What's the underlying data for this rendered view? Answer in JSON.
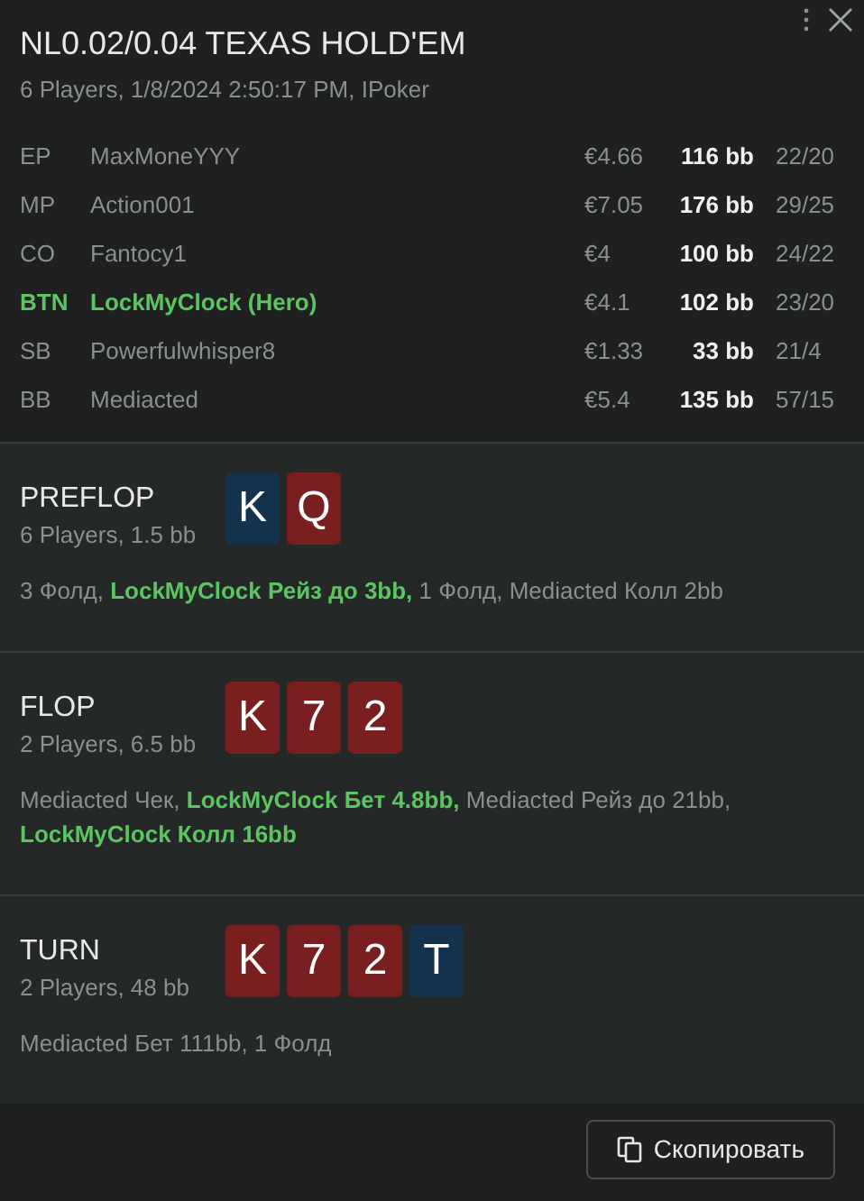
{
  "title": "NL0.02/0.04 TEXAS HOLD'EM",
  "subtitle": "6 Players, 1/8/2024 2:50:17 PM, IPoker",
  "players": [
    {
      "position": "EP",
      "name": "MaxMoneYYY",
      "money": "€4.66",
      "stack": "116 bb",
      "stats": "22/20",
      "hero": false
    },
    {
      "position": "MP",
      "name": "Action001",
      "money": "€7.05",
      "stack": "176 bb",
      "stats": "29/25",
      "hero": false
    },
    {
      "position": "CO",
      "name": "Fantocy1",
      "money": "€4",
      "stack": "100 bb",
      "stats": "24/22",
      "hero": false
    },
    {
      "position": "BTN",
      "name": "LockMyClock (Hero)",
      "money": "€4.1",
      "stack": "102 bb",
      "stats": "23/20",
      "hero": true
    },
    {
      "position": "SB",
      "name": "Powerfulwhisper8",
      "money": "€1.33",
      "stack": "33 bb",
      "stats": "21/4",
      "hero": false
    },
    {
      "position": "BB",
      "name": "Mediacted",
      "money": "€5.4",
      "stack": "135 bb",
      "stats": "57/15",
      "hero": false
    }
  ],
  "streets": [
    {
      "name": "PREFLOP",
      "info": "6 Players, 1.5 bb",
      "cards": [
        {
          "rank": "K",
          "color": "#15324d"
        },
        {
          "rank": "Q",
          "color": "#7a1f1f"
        }
      ],
      "actions": [
        {
          "text": "3 Фолд, ",
          "hero": false
        },
        {
          "text": "LockMyClock Рейз до 3bb,",
          "hero": true
        },
        {
          "text": " 1 Фолд, Mediacted Колл 2bb",
          "hero": false
        }
      ]
    },
    {
      "name": "FLOP",
      "info": "2 Players, 6.5 bb",
      "cards": [
        {
          "rank": "K",
          "color": "#7a1f1f"
        },
        {
          "rank": "7",
          "color": "#7a1f1f"
        },
        {
          "rank": "2",
          "color": "#7a1f1f"
        }
      ],
      "actions": [
        {
          "text": "Mediacted Чек, ",
          "hero": false
        },
        {
          "text": "LockMyClock Бет 4.8bb,",
          "hero": true
        },
        {
          "text": " Mediacted Рейз до 21bb, ",
          "hero": false
        },
        {
          "text": "LockMyClock Колл 16bb",
          "hero": true
        }
      ]
    },
    {
      "name": "TURN",
      "info": "2 Players, 48 bb",
      "cards": [
        {
          "rank": "K",
          "color": "#7a1f1f"
        },
        {
          "rank": "7",
          "color": "#7a1f1f"
        },
        {
          "rank": "2",
          "color": "#7a1f1f"
        },
        {
          "rank": "T",
          "color": "#15324d"
        }
      ],
      "actions": [
        {
          "text": "Mediacted Бет 111bb, 1 Фолд",
          "hero": false
        }
      ]
    }
  ],
  "copy_button": "Скопировать"
}
